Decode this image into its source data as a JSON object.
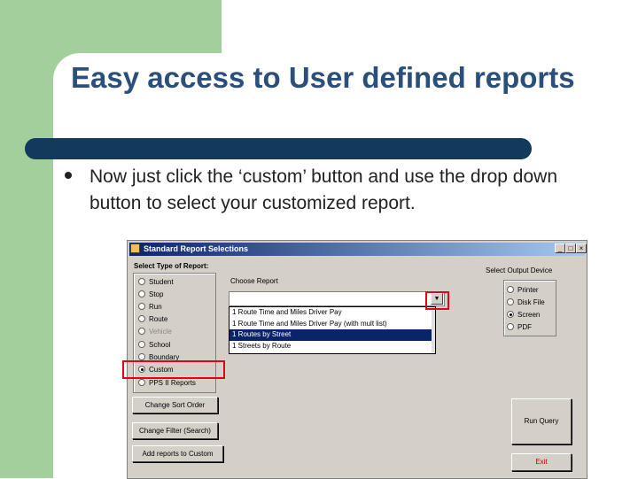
{
  "slide": {
    "title": "Easy access to User defined reports",
    "bullet": "Now just click the ‘custom’ button and use the drop down button to select your customized report."
  },
  "dialog": {
    "title": "Standard Report Selections",
    "window_buttons": {
      "minimize": "_",
      "maximize": "□",
      "close": "×"
    },
    "report_type": {
      "label": "Select Type of Report:",
      "options": [
        {
          "label": "Student",
          "selected": false,
          "disabled": false
        },
        {
          "label": "Stop",
          "selected": false,
          "disabled": false
        },
        {
          "label": "Run",
          "selected": false,
          "disabled": false
        },
        {
          "label": "Route",
          "selected": false,
          "disabled": false
        },
        {
          "label": "Vehicle",
          "selected": false,
          "disabled": true
        },
        {
          "label": "School",
          "selected": false,
          "disabled": false
        },
        {
          "label": "Boundary",
          "selected": false,
          "disabled": false
        },
        {
          "label": "Custom",
          "selected": true,
          "disabled": false
        },
        {
          "label": "PPS II Reports",
          "selected": false,
          "disabled": false
        }
      ]
    },
    "choose_report": {
      "label": "Choose Report",
      "value": "",
      "dropdown_items": [
        {
          "label": "1 Route Time and Miles Driver Pay",
          "selected": false
        },
        {
          "label": "1 Route Time and Miles Driver Pay (with mult list)",
          "selected": false
        },
        {
          "label": "1 Routes by Street",
          "selected": true
        },
        {
          "label": "1 Streets by Route",
          "selected": false
        }
      ]
    },
    "output_device": {
      "label": "Select Output Device",
      "options": [
        {
          "label": "Printer",
          "selected": false
        },
        {
          "label": "Disk File",
          "selected": false
        },
        {
          "label": "Screen",
          "selected": true
        },
        {
          "label": "PDF",
          "selected": false
        }
      ]
    },
    "buttons": {
      "change_sort": "Change Sort Order",
      "change_filter": "Change Filter (Search)",
      "add_to_custom": "Add reports to Custom",
      "run_query": "Run Query",
      "exit": "Exit"
    },
    "colors": {
      "highlight": "#e0001a",
      "exit_text": "#c00000"
    }
  }
}
